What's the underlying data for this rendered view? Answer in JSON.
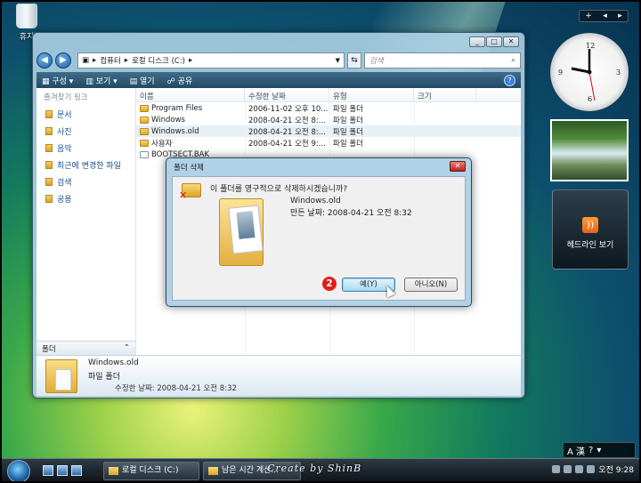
{
  "desktop": {
    "recycle_label": "휴지"
  },
  "explorer": {
    "breadcrumb": [
      "컴퓨터",
      "로컬 디스크 (C:)"
    ],
    "search_placeholder": "검색",
    "commands": [
      "구성",
      "보기",
      "열기",
      "공유"
    ],
    "favorites_title": "즐겨찾기 링크",
    "favorites": [
      "문서",
      "사진",
      "음악",
      "최근에 변경한 파일",
      "검색",
      "공용"
    ],
    "folders_label": "폴더",
    "columns": [
      "이름",
      "수정한 날짜",
      "유형",
      "크기"
    ],
    "rows": [
      {
        "name": "Program Files",
        "date": "2006-11-02 오후 10...",
        "type": "파일 폴더",
        "size": ""
      },
      {
        "name": "Windows",
        "date": "2008-04-21 오전 8:...",
        "type": "파일 폴더",
        "size": ""
      },
      {
        "name": "Windows.old",
        "date": "2008-04-21 오전 8:...",
        "type": "파일 폴더",
        "size": ""
      },
      {
        "name": "사용자",
        "date": "2008-04-21 오전 9:...",
        "type": "파일 폴더",
        "size": ""
      },
      {
        "name": "BOOTSECT.BAK",
        "date": "",
        "type": "",
        "size": ""
      }
    ],
    "detail": {
      "name": "Windows.old",
      "type": "파일 폴더",
      "modified": "수정한 날짜: 2008-04-21 오전 8:32"
    }
  },
  "dialog": {
    "title": "폴더 삭제",
    "question": "이 폴더를 영구적으로 삭제하시겠습니까?",
    "folder_name": "Windows.old",
    "folder_date": "만든 날짜: 2008-04-21 오전 8:32",
    "step_marker": "2",
    "yes_label": "예(Y)",
    "no_label": "아니오(N)"
  },
  "sidebar": {
    "feed_label": "헤드라인 보기",
    "clock_numbers": [
      "12",
      "3",
      "6",
      "9"
    ]
  },
  "taskbar": {
    "tasks": [
      "로컬 디스크 (C:)",
      "남은 시간 계산..."
    ],
    "watermark": "Create by ShinB",
    "clock": "오전 9:28",
    "lang_label": "A 漢"
  }
}
